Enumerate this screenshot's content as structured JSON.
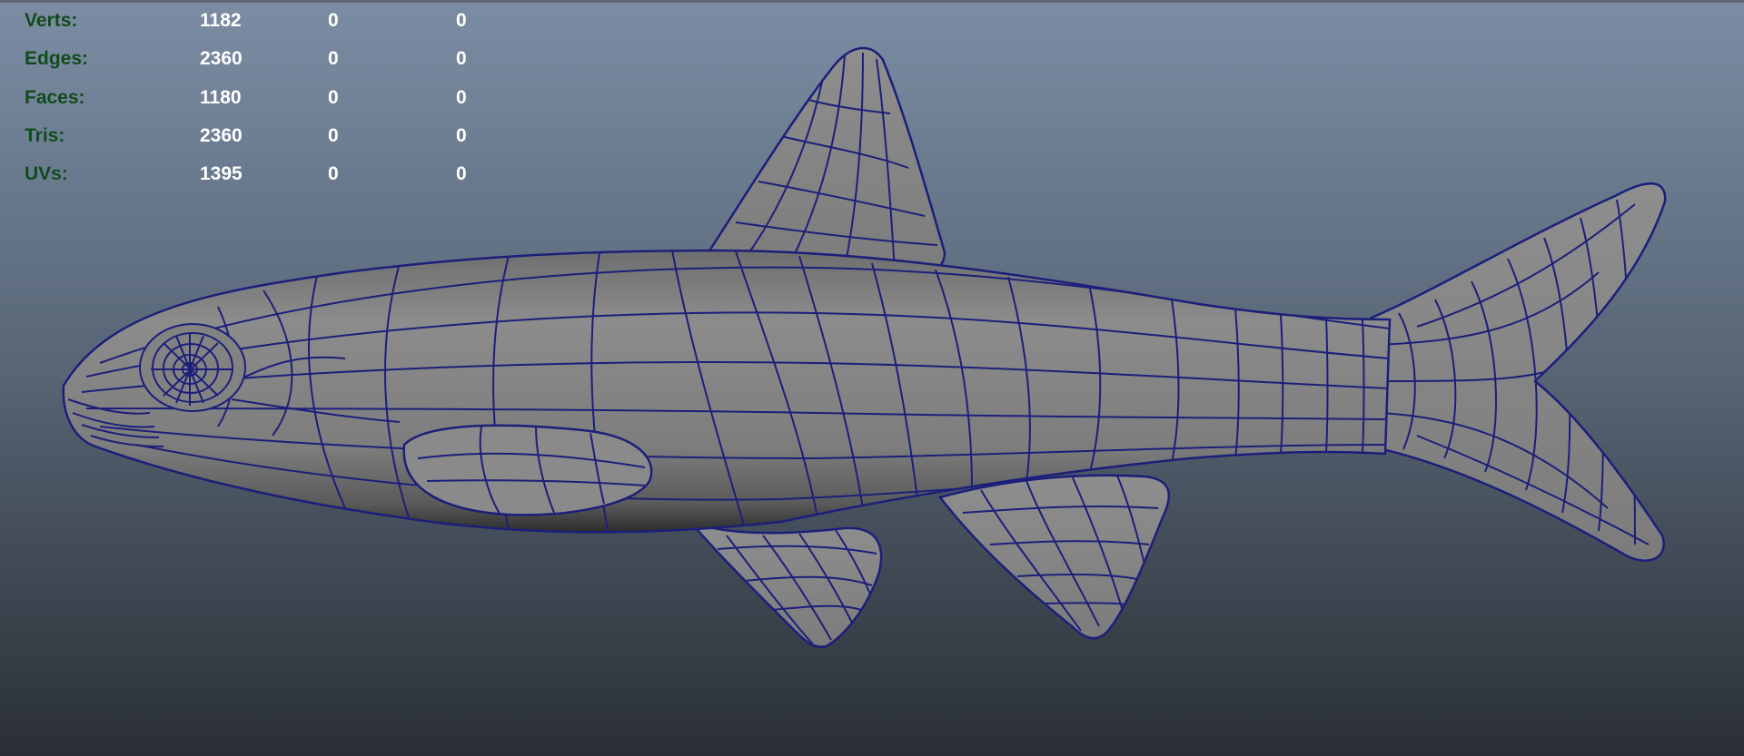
{
  "heads_up_display": {
    "rows": [
      {
        "label": "Verts:",
        "values": [
          "1182",
          "0",
          "0"
        ]
      },
      {
        "label": "Edges:",
        "values": [
          "2360",
          "0",
          "0"
        ]
      },
      {
        "label": "Faces:",
        "values": [
          "1180",
          "0",
          "0"
        ]
      },
      {
        "label": "Tris:",
        "values": [
          "2360",
          "0",
          "0"
        ]
      },
      {
        "label": "UVs:",
        "values": [
          "1395",
          "0",
          "0"
        ]
      }
    ]
  },
  "colors": {
    "viewport_top": "#7c8ca3",
    "viewport_bottom": "#2a2f36",
    "hud_label": "#0f4a1e",
    "hud_value": "#ffffff",
    "mesh_fill": "#8a8a8a",
    "wireframe": "#1c1f7a"
  }
}
